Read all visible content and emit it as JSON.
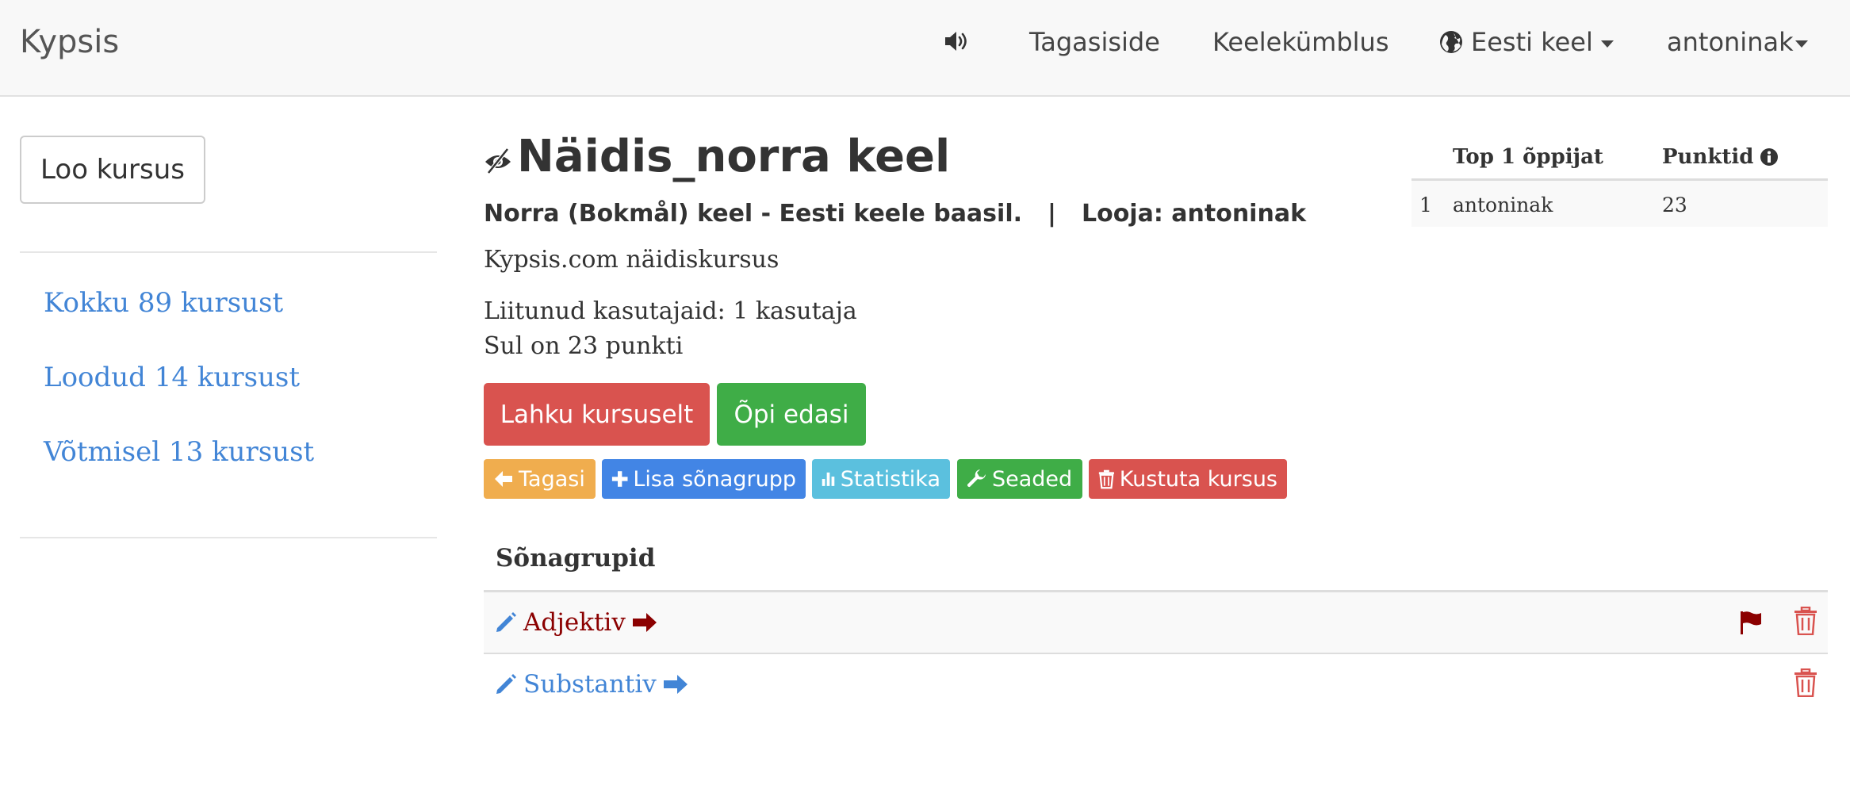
{
  "navbar": {
    "brand": "Kypsis",
    "speaker_icon": "speaker-icon",
    "feedback": "Tagasiside",
    "immersion": "Keelekümblus",
    "language": "Eesti keel",
    "user": "antoninak"
  },
  "sidebar": {
    "new_course": "Loo kursus",
    "links": [
      {
        "label": "Kokku 89 kursust"
      },
      {
        "label": "Loodud 14 kursust"
      },
      {
        "label": "Võtmisel 13 kursust"
      }
    ]
  },
  "course": {
    "title": "Näidis_norra keel",
    "subtitle_language": "Norra (Bokmål) keel - Eesti keele baasil.",
    "subtitle_sep": "|",
    "subtitle_creator": "Looja: antoninak",
    "description": "Kypsis.com näidiskursus",
    "joined": "Liitunud kasutajaid: 1 kasutaja",
    "points": "Sul on 23 punkti"
  },
  "actions": {
    "leave": "Lahku kursuselt",
    "learn": "Õpi edasi",
    "back": "Tagasi",
    "add_group": "Lisa sõnagrupp",
    "stats": "Statistika",
    "settings": "Seaded",
    "delete": "Kustuta kursus"
  },
  "groups": {
    "header": "Sõnagrupid",
    "rows": [
      {
        "name": "Adjektiv"
      },
      {
        "name": "Substantiv"
      }
    ]
  },
  "leaderboard": {
    "col_learner": "Top 1 õppijat",
    "col_points": "Punktid",
    "rows": [
      {
        "rank": "1",
        "name": "antoninak",
        "points": "23"
      }
    ]
  },
  "colors": {
    "danger": "#d9534f",
    "success": "#3fad47",
    "warning": "#f0ad4e",
    "primary": "#4285e5",
    "info": "#5bc0de",
    "link": "#4285d6",
    "dark_red": "#8b0000"
  }
}
